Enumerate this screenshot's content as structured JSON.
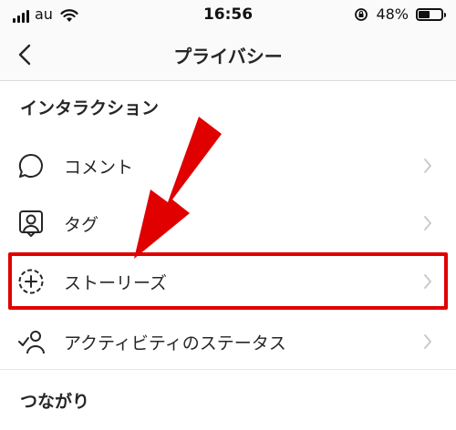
{
  "status_bar": {
    "carrier": "au",
    "time": "16:56",
    "battery_percent": "48%",
    "battery_level": 0.48
  },
  "nav": {
    "title": "プライバシー"
  },
  "sections": [
    {
      "header": "インタラクション",
      "items": [
        {
          "label": "コメント",
          "icon": "comment-bubble-icon"
        },
        {
          "label": "タグ",
          "icon": "person-tag-icon"
        },
        {
          "label": "ストーリーズ",
          "icon": "story-plus-icon"
        },
        {
          "label": "アクティビティのステータス",
          "icon": "activity-status-icon"
        }
      ]
    },
    {
      "header": "つながり",
      "items": []
    }
  ],
  "annotation": {
    "highlight_color": "#e00000",
    "highlighted_item": "ストーリーズ"
  }
}
